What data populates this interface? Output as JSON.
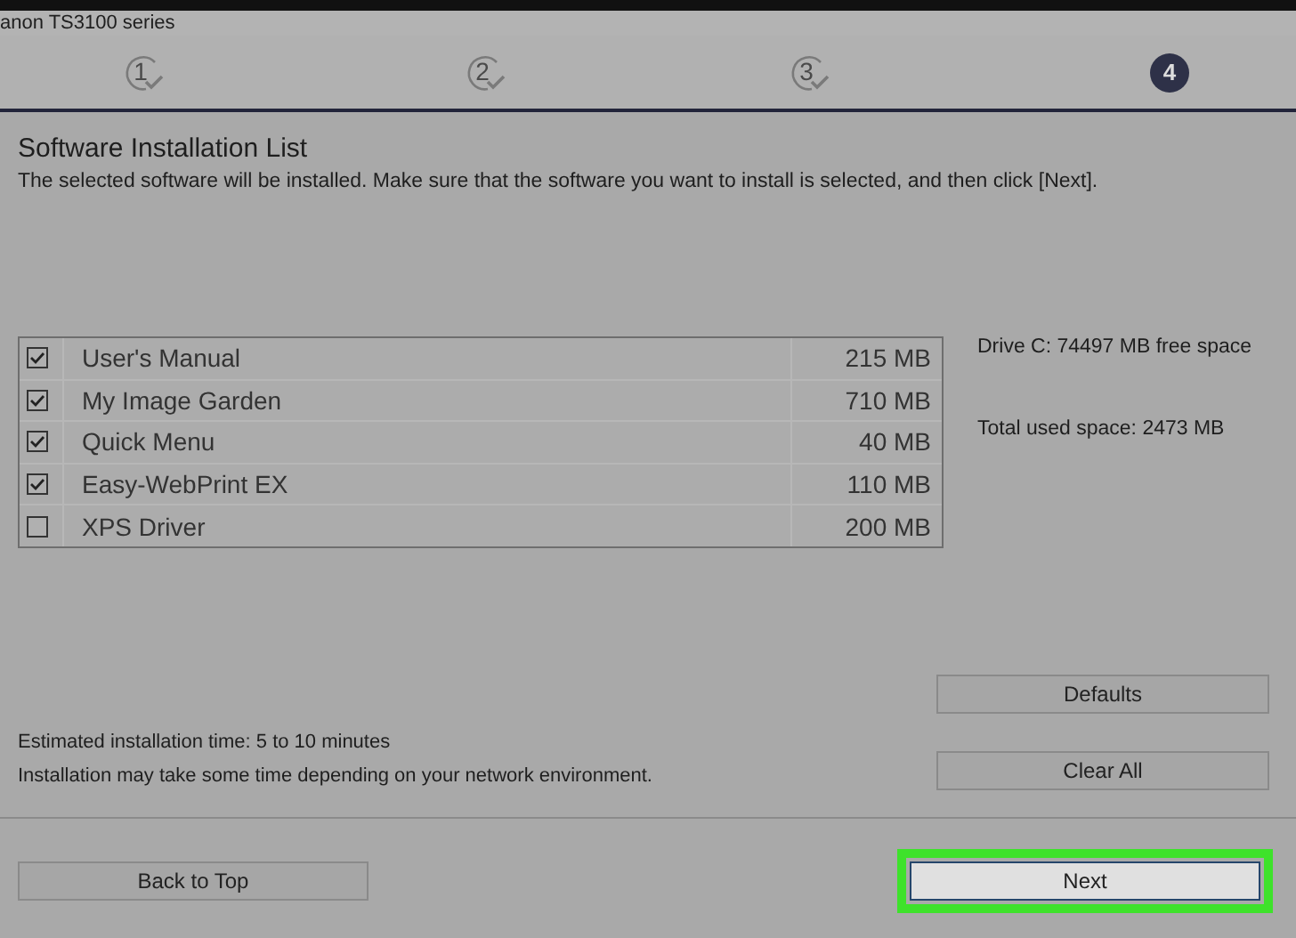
{
  "window": {
    "title": "anon TS3100 series"
  },
  "steps": [
    {
      "label": "1",
      "completed": true
    },
    {
      "label": "2",
      "completed": true
    },
    {
      "label": "3",
      "completed": true
    },
    {
      "label": "4",
      "completed": false
    }
  ],
  "heading": "Software Installation List",
  "description": "The selected software will be installed. Make sure that the software you want to install is selected, and then click [Next].",
  "software": [
    {
      "name": "User's Manual",
      "size": "215 MB",
      "checked": true
    },
    {
      "name": "My Image Garden",
      "size": "710 MB",
      "checked": true
    },
    {
      "name": "Quick Menu",
      "size": "40 MB",
      "checked": true
    },
    {
      "name": "Easy-WebPrint EX",
      "size": "110 MB",
      "checked": true
    },
    {
      "name": "XPS Driver",
      "size": "200 MB",
      "checked": false
    }
  ],
  "free_space": "Drive C: 74497 MB free space",
  "used_space": "Total used space: 2473 MB",
  "notes": [
    "Estimated installation time: 5 to 10 minutes",
    "Installation may take some time depending on your network environment."
  ],
  "list_buttons": [
    "Defaults",
    "Clear All"
  ],
  "footer_buttons": [
    {
      "label": "Back to Top",
      "highlighted": false
    },
    {
      "label": "Next",
      "highlighted": true
    }
  ]
}
